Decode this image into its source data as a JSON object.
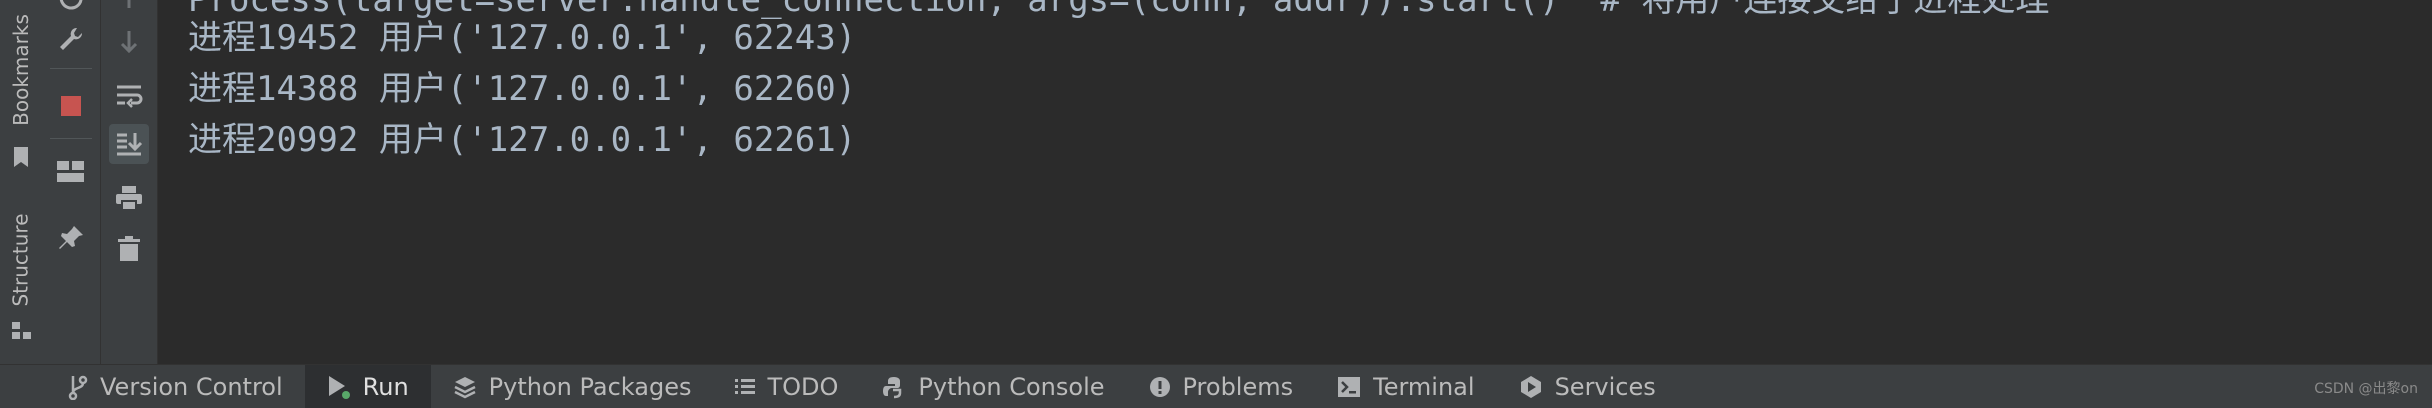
{
  "left_strip": {
    "bookmarks_label": "Bookmarks",
    "structure_label": "Structure"
  },
  "console": {
    "partial_line": "Process(target=server.handle_connection, args=(conn, addr)).start()  # 将用户连接交给子进程处理",
    "lines": [
      "进程19452 用户('127.0.0.1', 62243)",
      "进程14388 用户('127.0.0.1', 62260)",
      "进程20992 用户('127.0.0.1', 62261)"
    ]
  },
  "bottom_bar": {
    "tabs": [
      {
        "label": "Version Control",
        "icon": "branch-icon"
      },
      {
        "label": "Run",
        "icon": "run-icon"
      },
      {
        "label": "Python Packages",
        "icon": "layers-icon"
      },
      {
        "label": "TODO",
        "icon": "list-icon"
      },
      {
        "label": "Python Console",
        "icon": "python-icon"
      },
      {
        "label": "Problems",
        "icon": "warning-icon"
      },
      {
        "label": "Terminal",
        "icon": "terminal-icon"
      },
      {
        "label": "Services",
        "icon": "services-icon"
      }
    ]
  },
  "watermark": "CSDN @出黎on",
  "colors": {
    "background": "#2b2b2b",
    "panel": "#3c3f41",
    "console_text": "#a9b7c6",
    "stop_red": "#c75450",
    "run_green": "#59a869"
  }
}
